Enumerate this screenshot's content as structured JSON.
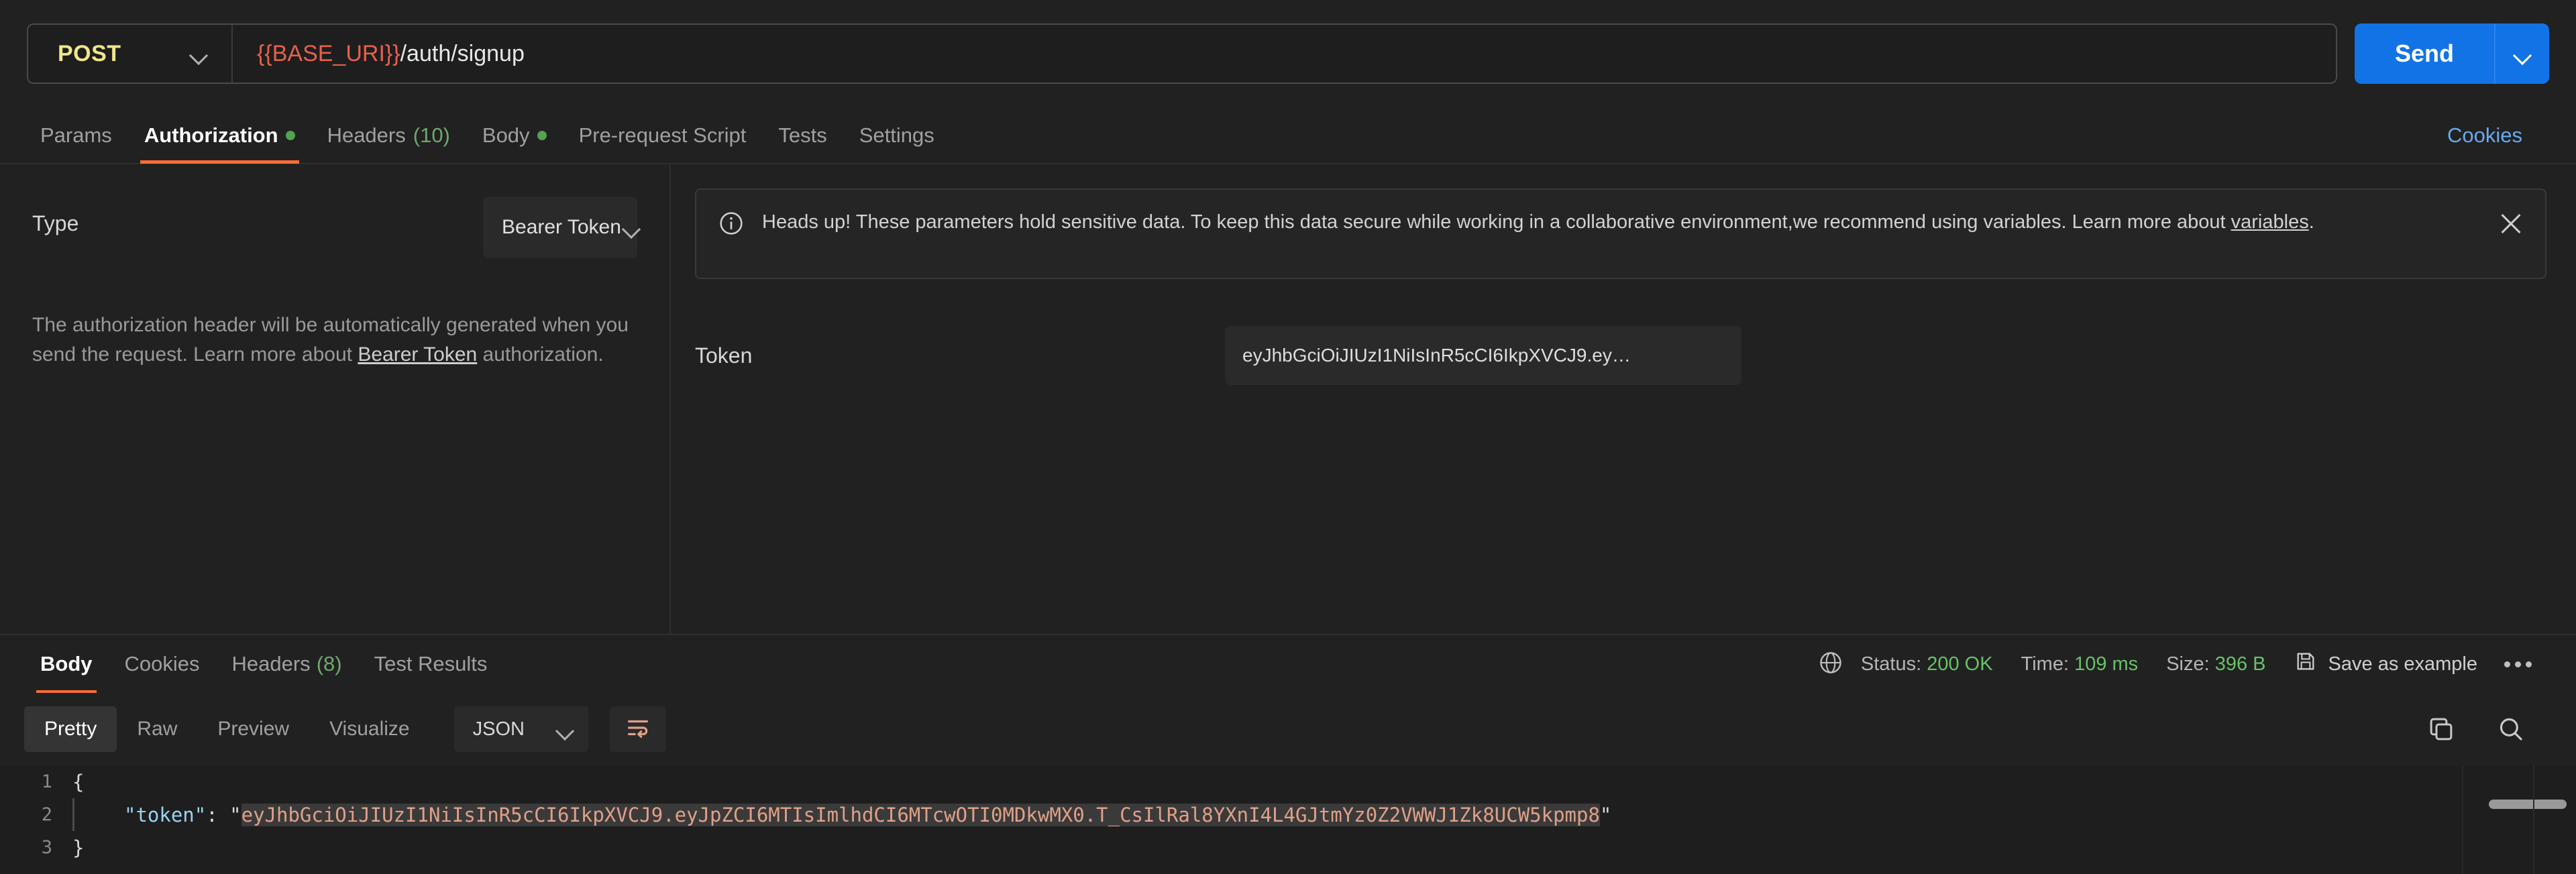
{
  "request": {
    "method": "POST",
    "url_variable": "{{BASE_URI}}",
    "url_path": "/auth/signup",
    "send_label": "Send",
    "tabs": [
      {
        "label": "Params",
        "active": false,
        "dot": false
      },
      {
        "label": "Authorization",
        "active": true,
        "dot": true
      },
      {
        "label": "Headers",
        "count": "(10)",
        "active": false,
        "dot": false
      },
      {
        "label": "Body",
        "active": false,
        "dot": true
      },
      {
        "label": "Pre-request Script",
        "active": false,
        "dot": false
      },
      {
        "label": "Tests",
        "active": false,
        "dot": false
      },
      {
        "label": "Settings",
        "active": false,
        "dot": false
      }
    ],
    "cookies_link": "Cookies"
  },
  "auth": {
    "type_label": "Type",
    "type_value": "Bearer Token",
    "description_part1": "The authorization header will be automatically generated when you send the request. Learn more about ",
    "description_link": "Bearer Token",
    "description_part2": " authorization.",
    "banner": {
      "text_part1": "Heads up! These parameters hold sensitive data. To keep this data secure while working in a collaborative environment,we recommend using variables. Learn more about ",
      "link": "variables",
      "text_part2": "."
    },
    "token_label": "Token",
    "token_value": "eyJhbGciOiJIUzI1NiIsInR5cCI6IkpXVCJ9.ey…"
  },
  "response": {
    "tabs": [
      {
        "label": "Body",
        "active": true
      },
      {
        "label": "Cookies",
        "active": false
      },
      {
        "label": "Headers",
        "count": "(8)",
        "active": false
      },
      {
        "label": "Test Results",
        "active": false
      }
    ],
    "status_label": "Status:",
    "status_value": "200 OK",
    "time_label": "Time:",
    "time_value": "109 ms",
    "size_label": "Size:",
    "size_value": "396 B",
    "save_example_label": "Save as example",
    "view_tabs": [
      {
        "label": "Pretty",
        "active": true
      },
      {
        "label": "Raw",
        "active": false
      },
      {
        "label": "Preview",
        "active": false
      },
      {
        "label": "Visualize",
        "active": false
      }
    ],
    "format_value": "JSON",
    "body": {
      "line1_num": "1",
      "line1_text": "{",
      "line2_num": "2",
      "line2_key": "\"token\"",
      "line2_colon": ": ",
      "line2_value": "eyJhbGciOiJIUzI1NiIsInR5cCI6IkpXVCJ9.eyJpZCI6MTIsImlhdCI6MTcwOTI0MDkwMX0.T_CsIlRal8YXnI4L4GJtmYz0Z2VWWJ1Zk8UCW5kpmp8",
      "line3_num": "3",
      "line3_text": "}"
    }
  },
  "colors": {
    "accent_orange": "#ff6c37",
    "send_blue": "#1273e6",
    "link_blue": "#6aa9f0",
    "status_green": "#67c267",
    "method_yellow": "#f0e68c",
    "url_variable_red": "#e8604c",
    "background": "#212121",
    "code_background": "#1e1e1e"
  }
}
